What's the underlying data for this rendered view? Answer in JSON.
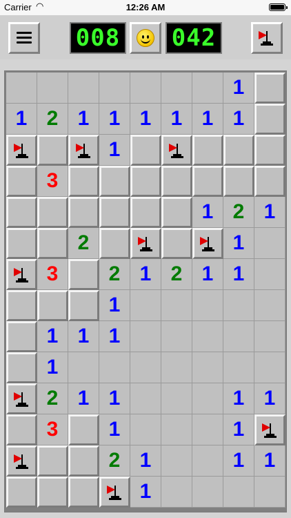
{
  "status_bar": {
    "carrier": "Carrier",
    "wifi_icon": "wifi-icon",
    "time": "12:26 AM",
    "battery_icon": "battery-icon"
  },
  "toolbar": {
    "menu_icon": "hamburger-menu-icon",
    "mines_remaining": "008",
    "reset_icon": "smiley-face-icon",
    "elapsed_time": "042",
    "flag_mode_icon": "flag-icon"
  },
  "colors": {
    "1": "#0000ff",
    "2": "#007b00",
    "3": "#ff0000",
    "lcd": "#3aff2a",
    "flag": "#e00000"
  },
  "board": {
    "columns": 9,
    "rows": 14,
    "legend": "H = hidden, E = revealed empty, F = flagged, digits = revealed number",
    "cells": [
      [
        "E",
        "E",
        "E",
        "E",
        "E",
        "E",
        "E",
        "1",
        "H"
      ],
      [
        "1",
        "2",
        "1",
        "1",
        "1",
        "1",
        "1",
        "1",
        "H"
      ],
      [
        "F",
        "H",
        "F",
        "1",
        "H",
        "F",
        "H",
        "H",
        "H"
      ],
      [
        "H",
        "3",
        "H",
        "H",
        "H",
        "H",
        "H",
        "H",
        "H"
      ],
      [
        "H",
        "H",
        "H",
        "H",
        "H",
        "H",
        "1",
        "2",
        "1"
      ],
      [
        "H",
        "H",
        "2",
        "H",
        "F",
        "H",
        "F",
        "1",
        "E"
      ],
      [
        "F",
        "3",
        "H",
        "2",
        "1",
        "2",
        "1",
        "1",
        "E"
      ],
      [
        "H",
        "H",
        "H",
        "1",
        "E",
        "E",
        "E",
        "E",
        "E"
      ],
      [
        "H",
        "1",
        "1",
        "1",
        "E",
        "E",
        "E",
        "E",
        "E"
      ],
      [
        "H",
        "1",
        "E",
        "E",
        "E",
        "E",
        "E",
        "E",
        "E"
      ],
      [
        "F",
        "2",
        "1",
        "1",
        "E",
        "E",
        "E",
        "1",
        "1"
      ],
      [
        "H",
        "3",
        "H",
        "1",
        "E",
        "E",
        "E",
        "1",
        "F"
      ],
      [
        "F",
        "H",
        "H",
        "2",
        "1",
        "E",
        "E",
        "1",
        "1"
      ],
      [
        "H",
        "H",
        "H",
        "F",
        "1",
        "E",
        "E",
        "E",
        "E"
      ]
    ]
  }
}
